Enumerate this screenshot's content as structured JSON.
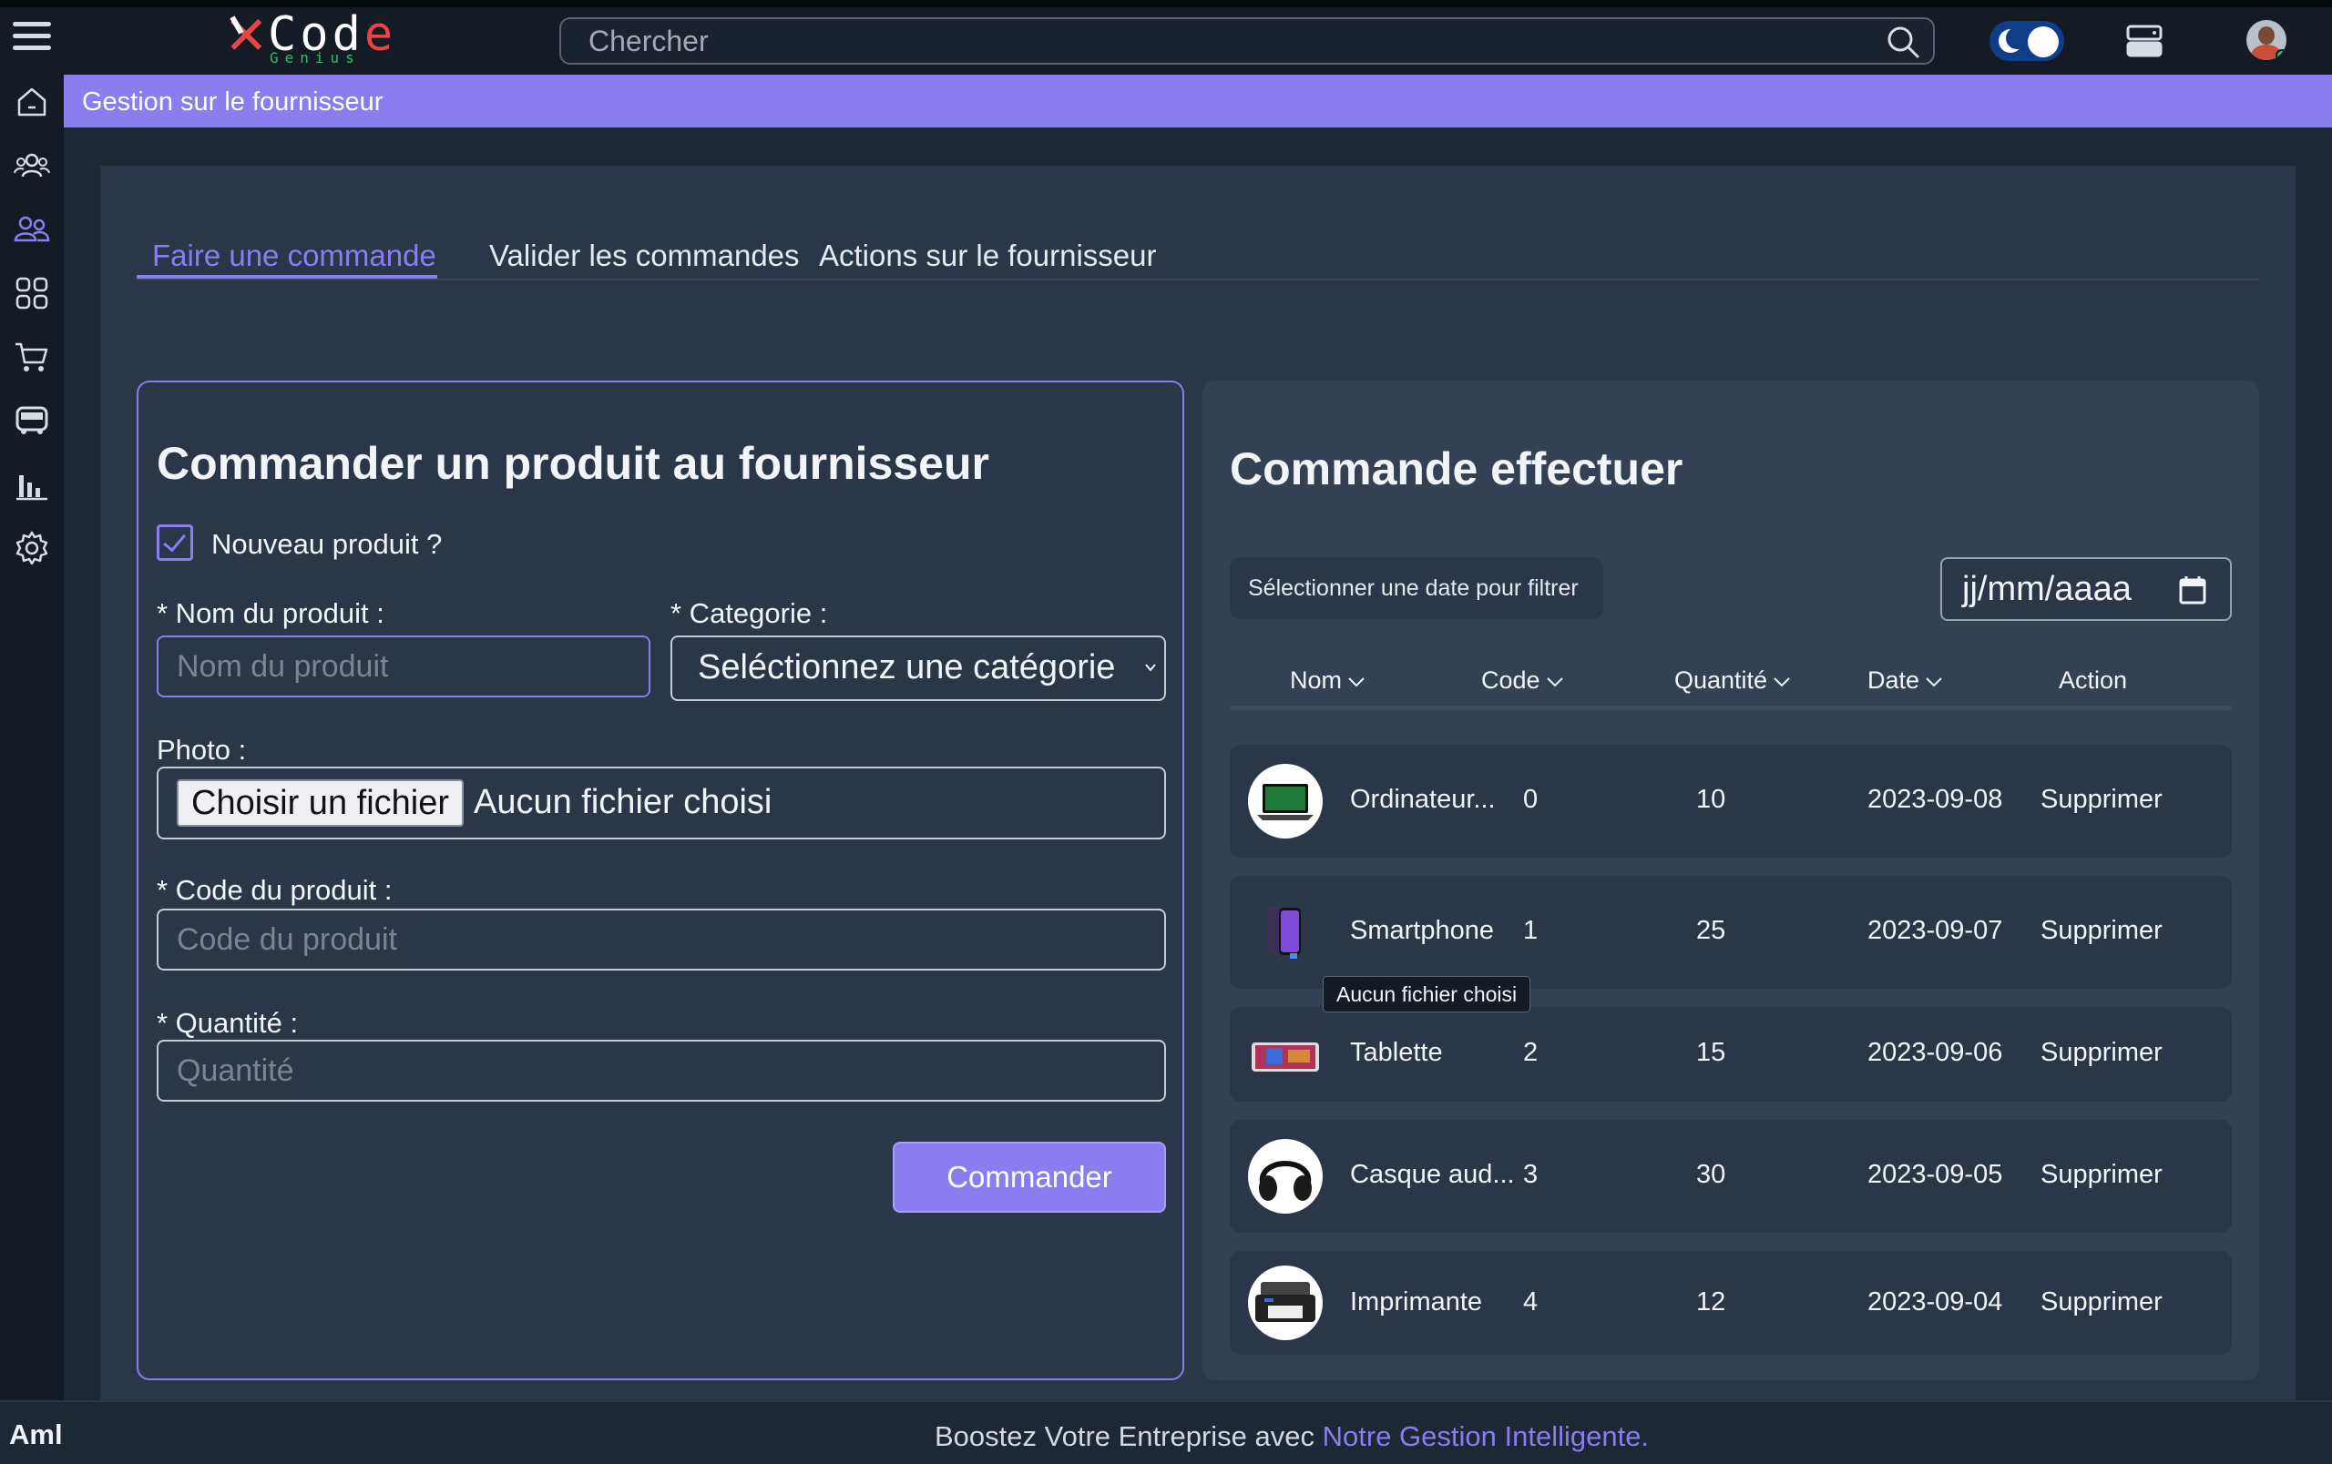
{
  "header": {
    "logo_text": "Code",
    "logo_sub": "Genius",
    "search_placeholder": "Chercher"
  },
  "sidebar": {
    "items": [
      {
        "icon": "home-icon"
      },
      {
        "icon": "users-icon"
      },
      {
        "icon": "suppliers-icon",
        "active": true
      },
      {
        "icon": "grid-icon"
      },
      {
        "icon": "cart-icon"
      },
      {
        "icon": "truck-icon"
      },
      {
        "icon": "bar-chart-icon"
      },
      {
        "icon": "gear-icon"
      }
    ]
  },
  "banner": {
    "title": "Gestion sur le fournisseur"
  },
  "tabs": [
    {
      "label": "Faire une commande",
      "active": true
    },
    {
      "label": "Valider les commandes",
      "active": false
    },
    {
      "label": "Actions sur le fournisseur",
      "active": false
    }
  ],
  "form": {
    "title": "Commander un produit au fournisseur",
    "new_product_label": "Nouveau produit ?",
    "new_product_checked": true,
    "name_label": "* Nom du produit :",
    "name_placeholder": "Nom du produit",
    "category_label": "* Categorie :",
    "category_value": "Seléctionnez une catégorie",
    "photo_label": "Photo :",
    "file_button": "Choisir un fichier",
    "file_status": "Aucun fichier choisi",
    "code_label": "* Code du produit :",
    "code_placeholder": "Code du produit",
    "qty_label": "* Quantité :",
    "qty_placeholder": "Quantité",
    "submit": "Commander"
  },
  "orders": {
    "title": "Commande effectuer",
    "filter_label": "Sélectionner une date pour filtrer",
    "date_placeholder": "jj/mm/aaaa",
    "columns": [
      "Nom",
      "Code",
      "Quantité",
      "Date",
      "Action"
    ],
    "rows": [
      {
        "name": "Ordinateur...",
        "code": "0",
        "qty": "10",
        "date": "2023-09-08",
        "action": "Supprimer",
        "thumb": "laptop"
      },
      {
        "name": "Smartphone",
        "code": "1",
        "qty": "25",
        "date": "2023-09-07",
        "action": "Supprimer",
        "thumb": "phone"
      },
      {
        "name": "Tablette",
        "code": "2",
        "qty": "15",
        "date": "2023-09-06",
        "action": "Supprimer",
        "thumb": "tablet"
      },
      {
        "name": "Casque aud...",
        "code": "3",
        "qty": "30",
        "date": "2023-09-05",
        "action": "Supprimer",
        "thumb": "headphones"
      },
      {
        "name": "Imprimante",
        "code": "4",
        "qty": "12",
        "date": "2023-09-04",
        "action": "Supprimer",
        "thumb": "printer"
      }
    ],
    "tooltip": "Aucun fichier choisi"
  },
  "footer": {
    "user": "Aml",
    "tagline_start": "Boostez Votre Entreprise avec ",
    "tagline_accent": "Notre Gestion Intelligente."
  },
  "colors": {
    "accent": "#8b7cf0",
    "background": "#1e2734",
    "panel": "#2b3648",
    "card": "#344155",
    "logo_red": "#e84545",
    "logo_green": "#2bbf6a"
  }
}
